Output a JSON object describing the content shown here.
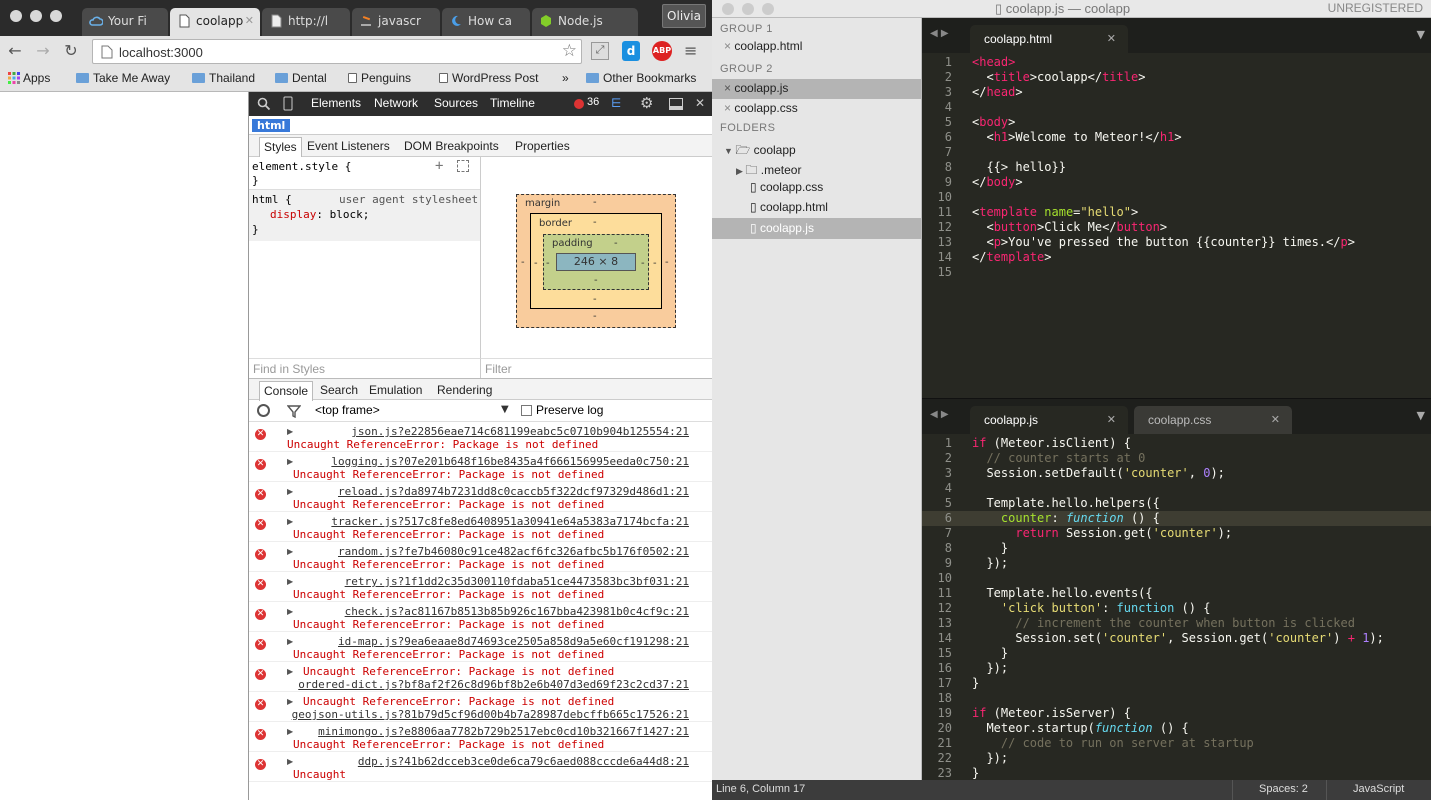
{
  "browser": {
    "tabs": [
      {
        "label": "Your Fi",
        "icon": "cloud-icon"
      },
      {
        "label": "coolapp",
        "icon": "document-icon"
      },
      {
        "label": "http://l",
        "icon": "document-icon"
      },
      {
        "label": "javascr",
        "icon": "stackoverflow-icon"
      },
      {
        "label": "How ca",
        "icon": "moon-icon"
      },
      {
        "label": "Node.js",
        "icon": "node-icon"
      }
    ],
    "user": "Olivia",
    "url": "localhost:3000",
    "bookmarks": [
      "Apps",
      "Take Me Away",
      "Thailand",
      "Dental",
      "Penguins",
      "WordPress Post",
      "»",
      "Other Bookmarks"
    ]
  },
  "devtools": {
    "tabs": [
      "Elements",
      "Network",
      "Sources",
      "Timeline"
    ],
    "error_count": "36",
    "crumb": "html",
    "subtabs": [
      "Styles",
      "Event Listeners",
      "DOM Breakpoints",
      "Properties"
    ],
    "styles": {
      "element_style": "element.style {",
      "close": "}",
      "html_rule": "html {",
      "ua": "user agent stylesheet",
      "prop": "display",
      "val": "block;"
    },
    "box": {
      "margin": "margin",
      "border": "border",
      "padding": "padding",
      "content": "246 × 8",
      "dash": "-"
    },
    "find_placeholder": "Find in Styles",
    "filter_placeholder": "Filter",
    "console_tabs": [
      "Console",
      "Search",
      "Emulation",
      "Rendering"
    ],
    "frame": "<top frame>",
    "preserve": "Preserve log",
    "logs": [
      {
        "file": "json.js?e22856eae714c681199eabc5c0710b904b125554:21",
        "msg": "Uncaught ReferenceError: Package is not defined"
      },
      {
        "file": "logging.js?07e201b648f16be8435a4f666156995eeda0c750:21",
        "msg": "Uncaught ReferenceError: Package is not defined"
      },
      {
        "file": "reload.js?da8974b7231dd8c0caccb5f322dcf97329d486d1:21",
        "msg": "Uncaught ReferenceError: Package is not defined"
      },
      {
        "file": "tracker.js?517c8fe8ed6408951a30941e64a5383a7174bcfa:21",
        "msg": "Uncaught ReferenceError: Package is not defined"
      },
      {
        "file": "random.js?fe7b46080c91ce482acf6fc326afbc5b176f0502:21",
        "msg": "Uncaught ReferenceError: Package is not defined"
      },
      {
        "file": "retry.js?1f1dd2c35d300110fdaba51ce4473583bc3bf031:21",
        "msg": "Uncaught ReferenceError: Package is not defined"
      },
      {
        "file": "check.js?ac81167b8513b85b926c167bba423981b0c4cf9c:21",
        "msg": "Uncaught ReferenceError: Package is not defined"
      },
      {
        "file": "id-map.js?9ea6eaae8d74693ce2505a858d9a5e60cf191298:21",
        "msg": "Uncaught ReferenceError: Package is not defined"
      },
      {
        "file": "ordered-dict.js?bf8af2f26c8d96bf8b2e6b407d3ed69f23c2cd37:21",
        "msg": "Uncaught ReferenceError: Package is not defined"
      },
      {
        "file": "geojson-utils.js?81b79d5cf96d00b4b7a28987debcffb665c17526:21",
        "msg": "Uncaught ReferenceError: Package is not defined"
      },
      {
        "file": "minimongo.js?e8806aa7782b729b2517ebc0cd10b321667f1427:21",
        "msg": "Uncaught ReferenceError: Package is not defined"
      },
      {
        "file": "ddp.js?41b62dcceb3ce0de6ca79c6aed088cccde6a44d8:21",
        "msg": "Uncaught"
      }
    ]
  },
  "editor": {
    "title": "coolapp.js — coolapp",
    "unregistered": "UNREGISTERED",
    "sidebar": {
      "group1": "GROUP 1",
      "group1_files": [
        "coolapp.html"
      ],
      "group2": "GROUP 2",
      "group2_files": [
        "coolapp.js",
        "coolapp.css"
      ],
      "folders": "FOLDERS",
      "root": "coolapp",
      "items": [
        ".meteor",
        "coolapp.css",
        "coolapp.html",
        "coolapp.js"
      ]
    },
    "top_tab": "coolapp.html",
    "bottom_tabs": [
      "coolapp.js",
      "coolapp.css"
    ],
    "status": {
      "pos": "Line 6, Column 17",
      "spaces": "Spaces: 2",
      "lang": "JavaScript"
    }
  }
}
